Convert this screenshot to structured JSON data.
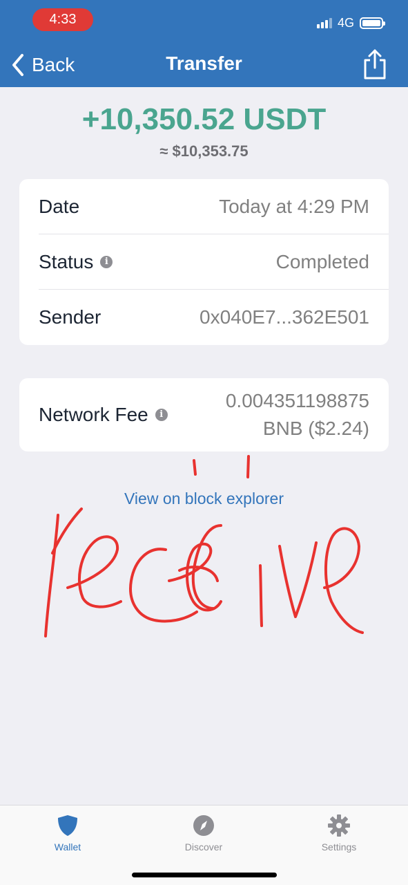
{
  "status_bar": {
    "time": "4:33",
    "network": "4G"
  },
  "nav": {
    "back_label": "Back",
    "title": "Transfer"
  },
  "transaction": {
    "amount": "+10,350.52 USDT",
    "fiat_equivalent": "≈ $10,353.75",
    "details": {
      "date_label": "Date",
      "date_value": "Today at 4:29 PM",
      "status_label": "Status",
      "status_value": "Completed",
      "sender_label": "Sender",
      "sender_value": "0x040E7...362E501"
    },
    "fee": {
      "label": "Network Fee",
      "value_line1": "0.004351198875",
      "value_line2": "BNB ($2.24)"
    },
    "explorer_link": "View on block explorer"
  },
  "handwritten_annotation": "receive",
  "tabbar": {
    "items": [
      {
        "label": "Wallet",
        "icon": "shield-icon",
        "active": true
      },
      {
        "label": "Discover",
        "icon": "compass-icon",
        "active": false
      },
      {
        "label": "Settings",
        "icon": "gear-icon",
        "active": false
      }
    ]
  },
  "colors": {
    "header": "#3375bb",
    "amount": "#4aa58f",
    "link": "#3375bb",
    "status_time_pill": "#e03a36",
    "annotation": "#e8322f"
  }
}
